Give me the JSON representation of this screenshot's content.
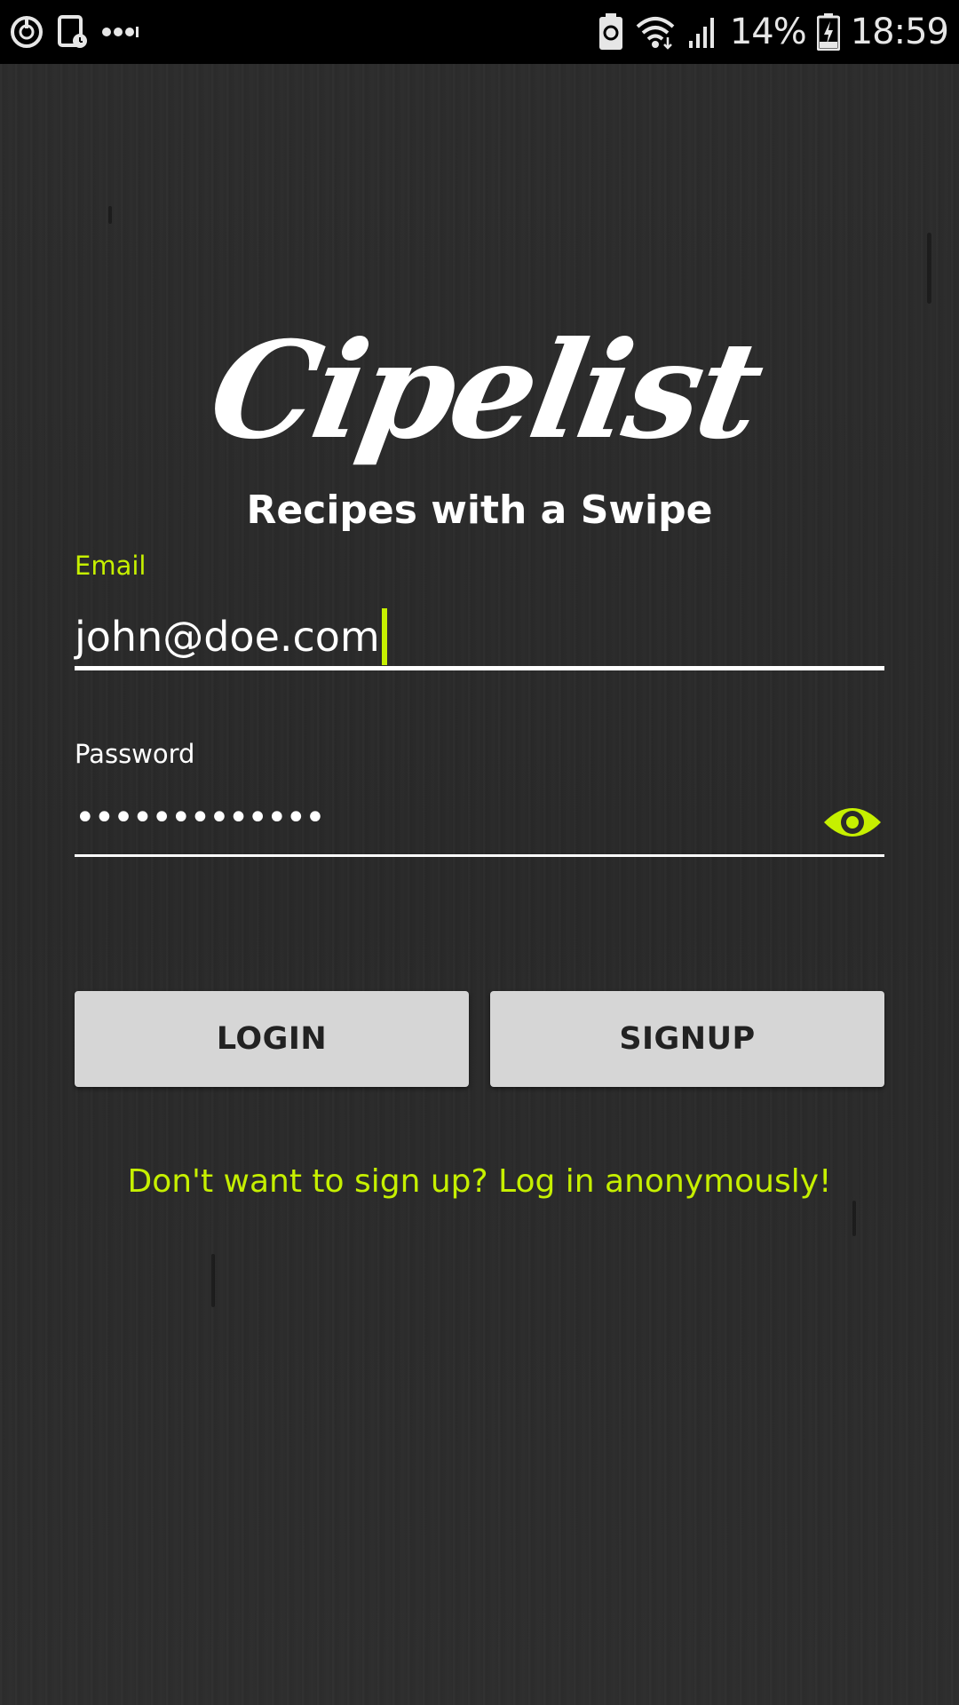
{
  "status_bar": {
    "battery_percent": "14%",
    "time": "18:59",
    "left_icons": [
      "power-saving-icon",
      "screenshot-icon",
      "more-notifications-icon"
    ],
    "right_icons": [
      "battery-saver-icon",
      "wifi-icon",
      "signal-icon",
      "battery-charging-icon"
    ]
  },
  "logo": {
    "wordmark": "Cipelist",
    "tagline": "Recipes with a Swipe"
  },
  "form": {
    "email": {
      "label": "Email",
      "value": "john@doe.com"
    },
    "password": {
      "label": "Password",
      "value": "•••••••••••••",
      "toggle_icon": "eye-icon"
    }
  },
  "buttons": {
    "login_label": "LOGIN",
    "signup_label": "SIGNUP"
  },
  "anonymous_link": "Don't want to sign up? Log in anonymously!",
  "colors": {
    "accent": "#c6f000",
    "background": "#2b2b2b",
    "button_bg": "#d6d6d6",
    "button_text": "#222222"
  }
}
